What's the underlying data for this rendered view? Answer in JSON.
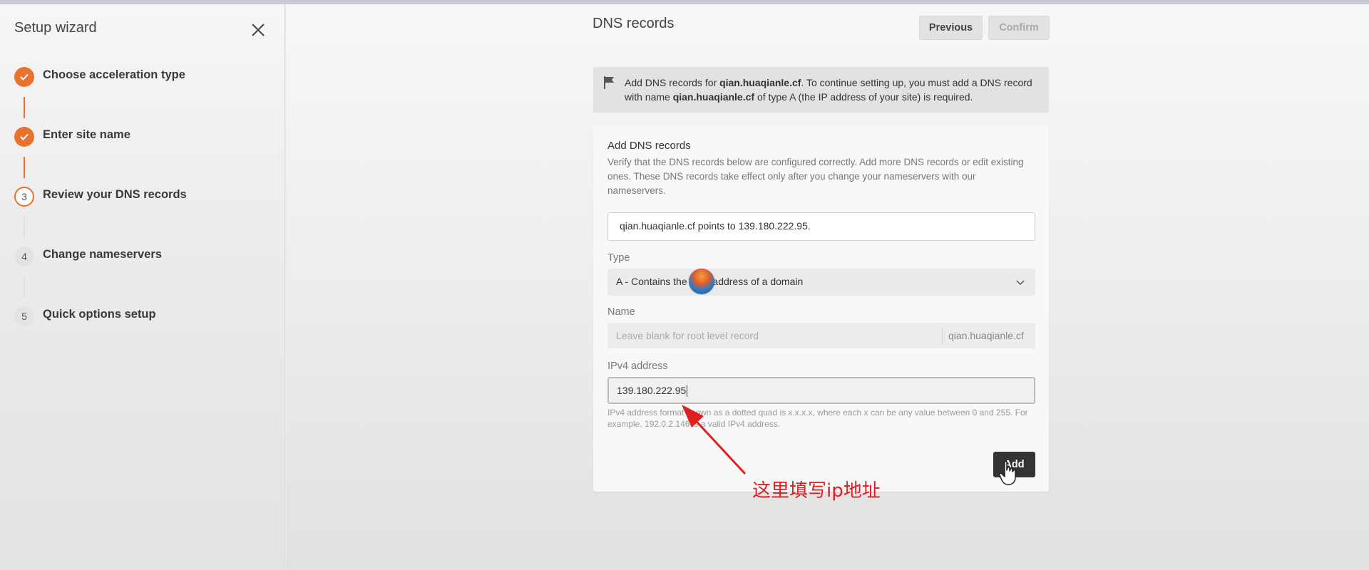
{
  "sidebar": {
    "title": "Setup wizard",
    "steps": [
      {
        "number": "1",
        "label": "Choose acceleration type",
        "status": "done"
      },
      {
        "number": "2",
        "label": "Enter site name",
        "status": "done"
      },
      {
        "number": "3",
        "label": "Review your DNS records",
        "status": "active"
      },
      {
        "number": "4",
        "label": "Change nameservers",
        "status": "todo"
      },
      {
        "number": "5",
        "label": "Quick options setup",
        "status": "todo"
      }
    ]
  },
  "header": {
    "title": "DNS records",
    "previous_label": "Previous",
    "confirm_label": "Confirm"
  },
  "notice": {
    "part1": "Add DNS records for ",
    "domain1": "qian.huaqianle.cf",
    "part2": ". To continue setting up, you must add a DNS record with name ",
    "domain2": "qian.huaqianle.cf",
    "part3": " of type A (the IP address of your site) is required."
  },
  "card": {
    "title": "Add DNS records",
    "description": "Verify that the DNS records below are configured correctly. Add more DNS records or edit existing ones. These DNS records take effect only after you change your nameservers with our nameservers.",
    "points_to": "qian.huaqianle.cf points to 139.180.222.95.",
    "type_label": "Type",
    "type_value": "A - Contains the IPv4 address of a domain",
    "name_label": "Name",
    "name_placeholder": "Leave blank for root level record",
    "name_suffix": "qian.huaqianle.cf",
    "ipv4_label": "IPv4 address",
    "ipv4_value": "139.180.222.95",
    "ipv4_hint": "IPv4 address format known as a dotted quad is x.x.x.x, where each x can be any value between 0 and 255. For example, 192.0.2.146 is a valid IPv4 address.",
    "add_label": "Add"
  },
  "annotation": {
    "text": "这里填写ip地址",
    "color": "#e02020"
  },
  "colors": {
    "accent": "#e9722e",
    "button_dark": "#333333"
  },
  "icons": [
    "close-icon",
    "check-icon",
    "flag-icon",
    "chevron-down-icon",
    "hand-cursor-icon"
  ]
}
